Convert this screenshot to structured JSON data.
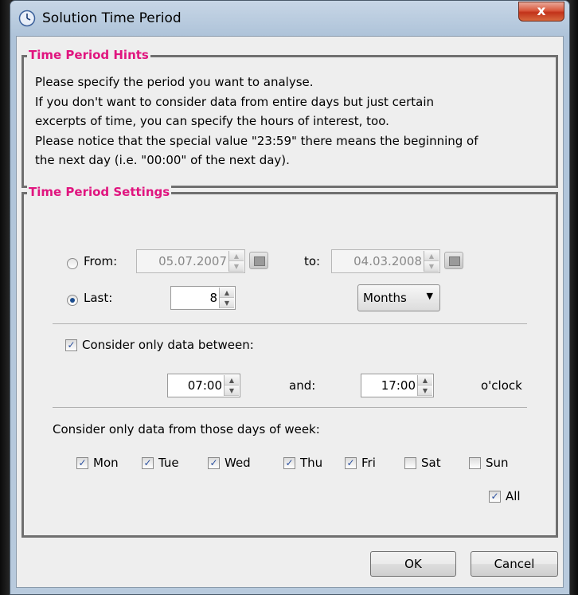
{
  "window": {
    "title": "Solution Time Period",
    "close_label": "x"
  },
  "hints": {
    "title": "Time Period Hints",
    "lines": [
      "Please specify the period you want to analyse.",
      "If you don't want to consider data from entire days but just certain",
      "excerpts of time, you can specify the hours of interest, too.",
      "Please notice that the special value \"23:59\" there means the beginning of",
      "the next day (i.e. \"00:00\" of the next day)."
    ]
  },
  "settings": {
    "title": "Time Period Settings",
    "from_label": "From:",
    "from_date": "05.07.2007",
    "to_label": "to:",
    "to_date": "04.03.2008",
    "last_label": "Last:",
    "last_value": "8",
    "last_unit": "Months",
    "from_selected": false,
    "last_selected": true,
    "time_filter_label": "Consider only data between:",
    "time_filter_checked": true,
    "start_time": "07:00",
    "and_label": "and:",
    "end_time": "17:00",
    "oclock_label": "o'clock",
    "days_label": "Consider only data from those days of week:",
    "days": [
      {
        "label": "Mon",
        "checked": true
      },
      {
        "label": "Tue",
        "checked": true
      },
      {
        "label": "Wed",
        "checked": true
      },
      {
        "label": "Thu",
        "checked": true
      },
      {
        "label": "Fri",
        "checked": true
      },
      {
        "label": "Sat",
        "checked": false
      },
      {
        "label": "Sun",
        "checked": false
      }
    ],
    "all_label": "All",
    "all_checked": true
  },
  "buttons": {
    "ok": "OK",
    "cancel": "Cancel"
  }
}
